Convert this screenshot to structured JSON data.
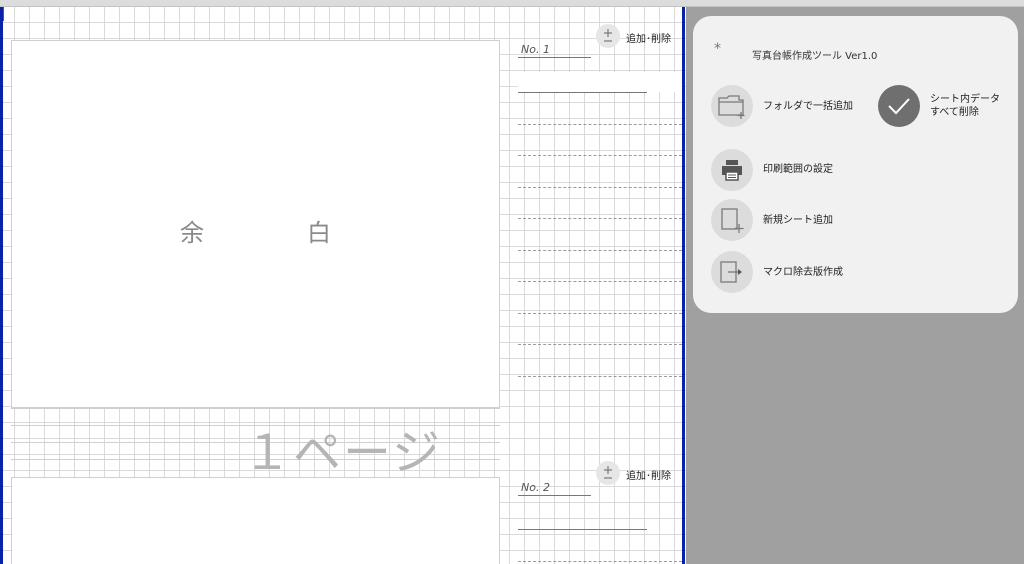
{
  "sheet": {
    "block_text_left": "余",
    "block_text_right": "白",
    "page_label": "１ページ",
    "entries": [
      {
        "no_label": "No. 1",
        "add_icon": "plus-minus-icon",
        "add_label": "追加･削除"
      },
      {
        "no_label": "No. 2",
        "add_icon": "plus-minus-icon",
        "add_label": "追加･削除"
      }
    ]
  },
  "panel": {
    "asterisk": "*",
    "title": "写真台帳作成ツール Ver1.0",
    "buttons": {
      "folder_add": {
        "icon": "folder-add-icon",
        "label": "フォルダで一括追加"
      },
      "delete_all": {
        "icon": "check-icon",
        "label_line1": "シート内データ",
        "label_line2": "すべて削除"
      },
      "print_range": {
        "icon": "printer-icon",
        "label": "印刷範囲の設定"
      },
      "new_sheet": {
        "icon": "new-sheet-icon",
        "label": "新規シート追加"
      },
      "macro_remove": {
        "icon": "export-icon",
        "label": "マクロ除去版作成"
      }
    }
  },
  "colors": {
    "sheet_border": "#0a22a8",
    "panel_bg": "#f1f1f1",
    "background": "#a0a0a0"
  }
}
